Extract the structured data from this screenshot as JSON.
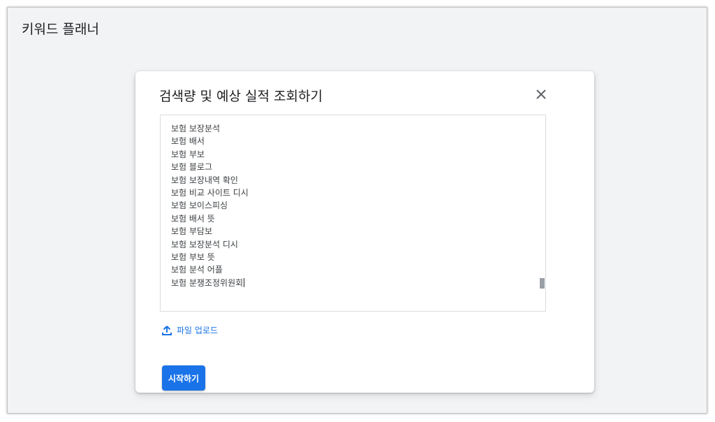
{
  "app": {
    "title": "키워드 플래너"
  },
  "dialog": {
    "title": "검색량 및 예상 실적 조회하기",
    "close_icon": "close-icon",
    "keywords": [
      "보험 보장분석",
      "보험 배서",
      "보험 부보",
      "보험 블로그",
      "보험 보장내역 확인",
      "보험 비교 사이트 디시",
      "보험 보이스피싱",
      "보험 배서 뜻",
      "보험 부담보",
      "보험 보장분석 디시",
      "보험 부보 뜻",
      "보험 분석 어플",
      "보험 분쟁조정위원회"
    ],
    "upload": {
      "icon": "upload-icon",
      "label": "파일 업로드"
    },
    "start_button": {
      "label": "시작하기",
      "color": "#1a73e8"
    }
  },
  "colors": {
    "accent": "#1a73e8",
    "background": "#f1f3f4",
    "text": "#202124"
  }
}
